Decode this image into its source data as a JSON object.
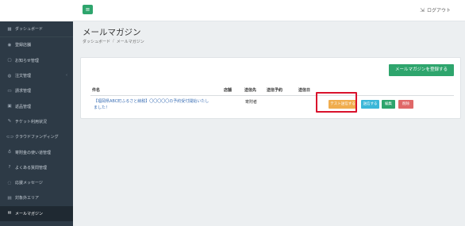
{
  "header": {
    "menu_icon": "≡",
    "logout_label": "ログアウト"
  },
  "sidebar": {
    "items": [
      {
        "label": "ダッシュボード",
        "icon": "dashboard-icon",
        "glyph": "▦"
      },
      {
        "label": "登録店舗",
        "icon": "store-icon",
        "glyph": "◉"
      },
      {
        "label": "お知らせ管理",
        "icon": "notice-icon",
        "glyph": "▢"
      },
      {
        "label": "注文管理",
        "icon": "cart-icon",
        "glyph": "◍",
        "has_chevron": true
      },
      {
        "label": "請求管理",
        "icon": "billing-icon",
        "glyph": "▭"
      },
      {
        "label": "返品管理",
        "icon": "return-icon",
        "glyph": "▣"
      },
      {
        "label": "チケット利用状況",
        "icon": "ticket-icon",
        "glyph": "✎"
      },
      {
        "label": "クラウドファンディング",
        "icon": "crowdfunding-icon",
        "glyph": "⊂⊃"
      },
      {
        "label": "寄附金の使い道管理",
        "icon": "donation-icon",
        "glyph": "♁"
      },
      {
        "label": "よくある質問管理",
        "icon": "faq-icon",
        "glyph": "?"
      },
      {
        "label": "応援メッセージ",
        "icon": "message-icon",
        "glyph": "◌"
      },
      {
        "label": "対象外エリア",
        "icon": "area-icon",
        "glyph": "▤"
      },
      {
        "label": "メールマガジン",
        "icon": "mail-icon",
        "glyph": "✉",
        "active": true
      }
    ]
  },
  "page": {
    "title": "メールマガジン",
    "breadcrumb": [
      "ダッシュボード",
      "メールマガジン"
    ]
  },
  "panel": {
    "register_button": "メールマガジンを登録する",
    "columns": [
      "件名",
      "店舗",
      "送信先",
      "送信予約",
      "送信日"
    ],
    "rows": [
      {
        "subject_line1": "【福岡県ABC町ふるさと納税】〇〇〇〇〇の予約受付開始いたし",
        "subject_line2": "ました！",
        "store": "",
        "recipient": "寄附者",
        "scheduled": "",
        "sent_date": "",
        "actions": {
          "test": "テスト送信する",
          "send": "送信する",
          "edit": "編集",
          "delete": "削除"
        }
      }
    ]
  },
  "colors": {
    "sidebar_bg": "#2d3a46",
    "accent_green": "#2ea56d",
    "test_orange": "#f0ad4e",
    "send_blue": "#3bb7d8",
    "delete_red": "#e06868",
    "highlight_red": "#d9122c"
  }
}
